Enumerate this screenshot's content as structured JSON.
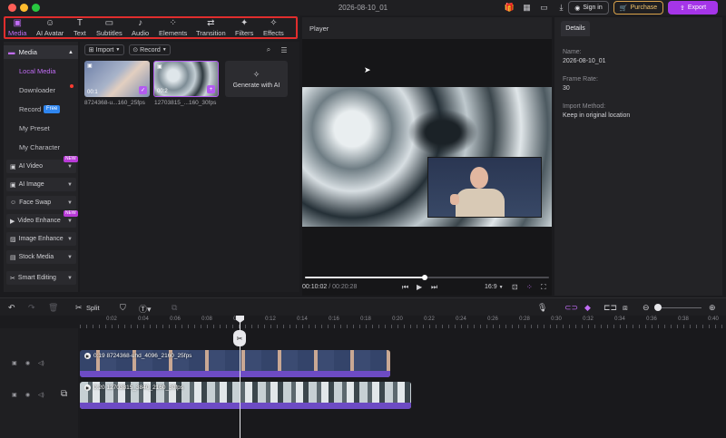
{
  "window": {
    "title": "2026-08-10_01",
    "signin_label": "Sign in",
    "purchase_label": "Purchase",
    "export_label": "Export"
  },
  "toolbar": {
    "items": [
      {
        "label": "Media",
        "icon": "media-icon"
      },
      {
        "label": "AI Avatar",
        "icon": "ai-avatar-icon"
      },
      {
        "label": "Text",
        "icon": "text-icon"
      },
      {
        "label": "Subtitles",
        "icon": "subtitles-icon"
      },
      {
        "label": "Audio",
        "icon": "audio-icon"
      },
      {
        "label": "Elements",
        "icon": "elements-icon"
      },
      {
        "label": "Transition",
        "icon": "transition-icon"
      },
      {
        "label": "Filters",
        "icon": "filters-icon"
      },
      {
        "label": "Effects",
        "icon": "effects-icon"
      }
    ],
    "active": "Media",
    "highlight_color": "#e02d2d"
  },
  "sidebar": {
    "media_label": "Media",
    "sub_items": [
      "Local Media",
      "Downloader",
      "Record",
      "My Preset",
      "My Character"
    ],
    "free_badge": "Free",
    "groups": [
      "AI Video",
      "AI Image",
      "Face Swap",
      "Video Enhance",
      "Image Enhance",
      "Stock Media",
      "Smart Editing"
    ],
    "new_badge": "NEW"
  },
  "media": {
    "import_label": "Import",
    "record_label": "Record",
    "clips": [
      {
        "name": "8724368-u...160_25fps",
        "duration": "00:1"
      },
      {
        "name": "12703815_...160_30fps",
        "duration": "00:2"
      }
    ],
    "generate_label": "Generate with AI"
  },
  "player": {
    "title": "Player",
    "current_time": "00:10:02",
    "total_time": "00:20:28",
    "ratio": "16:9",
    "progress": 0.49
  },
  "details": {
    "tab": "Details",
    "fields": [
      {
        "label": "Name:",
        "value": "2026-08-10_01"
      },
      {
        "label": "Frame Rate:",
        "value": "30"
      },
      {
        "label": "Import Method:",
        "value": "Keep in original location"
      }
    ]
  },
  "timeline": {
    "split_label": "Split",
    "ruler": [
      "0:02",
      "0:04",
      "0:06",
      "0:08",
      "0:10",
      "0:12",
      "0:14",
      "0:16",
      "0:18",
      "0:20",
      "0:22",
      "0:24",
      "0:26",
      "0:28",
      "0:30",
      "0:32",
      "0:34",
      "0:36",
      "0:38",
      "0:40"
    ],
    "clip1_label": "0:19 8724368-uhd_4096_2160_25fps",
    "clip2_label": "0:20 12703815_3840_2160_30fps"
  },
  "colors": {
    "accent": "#c16cf5",
    "export": "#a535e8",
    "purchase": "#d9a24a",
    "clip_bar": "#6d4bc4"
  }
}
